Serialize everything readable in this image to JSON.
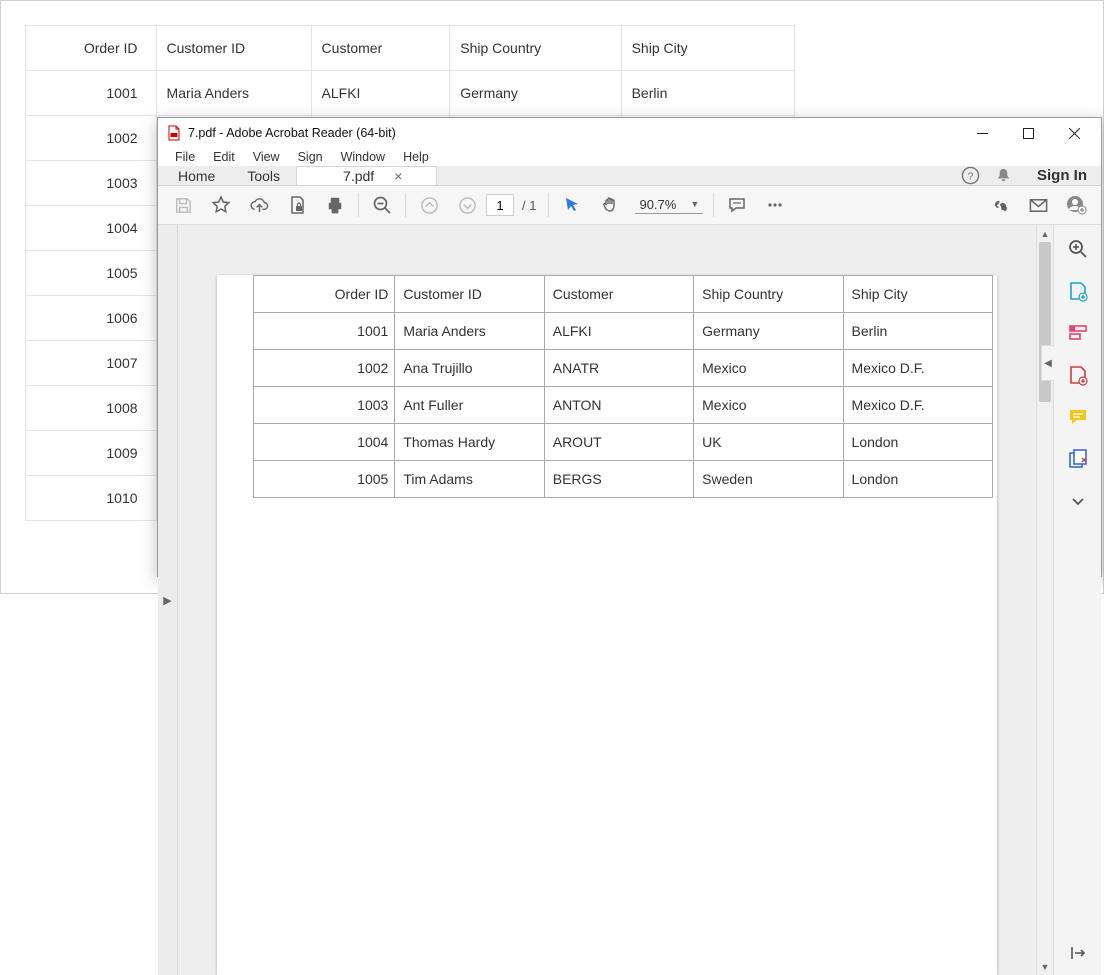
{
  "bg_grid": {
    "headers": [
      "Order ID",
      "Customer ID",
      "Customer",
      "Ship  Country",
      "Ship City"
    ],
    "rows": [
      [
        "1001",
        "Maria Anders",
        "ALFKI",
        "Germany",
        "Berlin"
      ],
      [
        "1002",
        "",
        "",
        "",
        ""
      ],
      [
        "1003",
        "",
        "",
        "",
        ""
      ],
      [
        "1004",
        "",
        "",
        "",
        ""
      ],
      [
        "1005",
        "",
        "",
        "",
        ""
      ],
      [
        "1006",
        "",
        "",
        "",
        ""
      ],
      [
        "1007",
        "",
        "",
        "",
        ""
      ],
      [
        "1008",
        "",
        "",
        "",
        ""
      ],
      [
        "1009",
        "",
        "",
        "",
        ""
      ],
      [
        "1010",
        "",
        "",
        "",
        ""
      ]
    ]
  },
  "acrobat": {
    "title": "7.pdf - Adobe Acrobat Reader (64-bit)",
    "menu": [
      "File",
      "Edit",
      "View",
      "Sign",
      "Window",
      "Help"
    ],
    "tab_home": "Home",
    "tab_tools": "Tools",
    "tab_doc": "7.pdf",
    "signin": "Sign In",
    "page_current": "1",
    "page_total": "/  1",
    "zoom": "90.7%"
  },
  "pdf_table": {
    "headers": [
      "Order ID",
      "Customer ID",
      "Customer",
      "Ship  Country",
      "Ship City"
    ],
    "rows": [
      [
        "1001",
        "Maria Anders",
        "ALFKI",
        "Germany",
        "Berlin"
      ],
      [
        "1002",
        "Ana Trujillo",
        "ANATR",
        "Mexico",
        "Mexico D.F."
      ],
      [
        "1003",
        "Ant Fuller",
        "ANTON",
        "Mexico",
        "Mexico D.F."
      ],
      [
        "1004",
        "Thomas Hardy",
        "AROUT",
        "UK",
        "London"
      ],
      [
        "1005",
        "Tim Adams",
        "BERGS",
        "Sweden",
        "London"
      ]
    ]
  }
}
